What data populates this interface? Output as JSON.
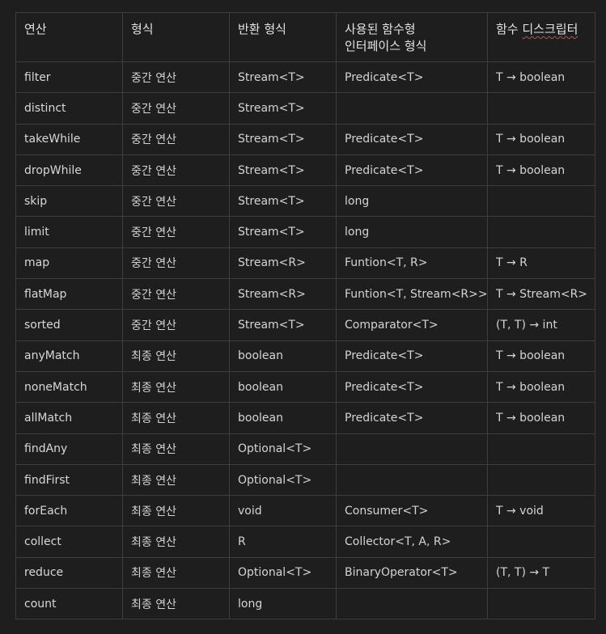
{
  "table": {
    "headers": {
      "op": "연산",
      "kind": "형식",
      "return_type": "반환 형식",
      "fi_type_line1": "사용된 함수형",
      "fi_type_line2": "인터페이스 형식",
      "descriptor_prefix": "함수 ",
      "descriptor_word": "디스크립터"
    },
    "rows": [
      {
        "op": "filter",
        "kind": "중간 연산",
        "ret": "Stream<T>",
        "fi": "Predicate<T>",
        "desc": "T → boolean"
      },
      {
        "op": "distinct",
        "kind": "중간 연산",
        "ret": "Stream<T>",
        "fi": "",
        "desc": ""
      },
      {
        "op": "takeWhile",
        "kind": "중간 연산",
        "ret": "Stream<T>",
        "fi": "Predicate<T>",
        "desc": "T → boolean"
      },
      {
        "op": "dropWhile",
        "kind": "중간 연산",
        "ret": "Stream<T>",
        "fi": "Predicate<T>",
        "desc": "T → boolean"
      },
      {
        "op": "skip",
        "kind": "중간 연산",
        "ret": "Stream<T>",
        "fi": "long",
        "desc": ""
      },
      {
        "op": "limit",
        "kind": "중간 연산",
        "ret": "Stream<T>",
        "fi": "long",
        "desc": ""
      },
      {
        "op": "map",
        "kind": "중간 연산",
        "ret": "Stream<R>",
        "fi": "Funtion<T, R>",
        "desc": "T → R"
      },
      {
        "op": "flatMap",
        "kind": "중간 연산",
        "ret": "Stream<R>",
        "fi": "Funtion<T, Stream<R>>",
        "desc": "T → Stream<R>"
      },
      {
        "op": "sorted",
        "kind": "중간 연산",
        "ret": "Stream<T>",
        "fi": "Comparator<T>",
        "desc": "(T, T) → int"
      },
      {
        "op": "anyMatch",
        "kind": "최종 연산",
        "ret": "boolean",
        "fi": "Predicate<T>",
        "desc": "T → boolean"
      },
      {
        "op": "noneMatch",
        "kind": "최종 연산",
        "ret": "boolean",
        "fi": "Predicate<T>",
        "desc": "T → boolean"
      },
      {
        "op": "allMatch",
        "kind": "최종 연산",
        "ret": "boolean",
        "fi": "Predicate<T>",
        "desc": "T → boolean"
      },
      {
        "op": "findAny",
        "kind": "최종 연산",
        "ret": "Optional<T>",
        "fi": "",
        "desc": ""
      },
      {
        "op": "findFirst",
        "kind": "최종 연산",
        "ret": "Optional<T>",
        "fi": "",
        "desc": ""
      },
      {
        "op": "forEach",
        "kind": "최종 연산",
        "ret": "void",
        "fi": "Consumer<T>",
        "desc": "T → void"
      },
      {
        "op": "collect",
        "kind": "최종 연산",
        "ret": "R",
        "fi": "Collector<T, A, R>",
        "desc": ""
      },
      {
        "op": "reduce",
        "kind": "최종 연산",
        "ret": "Optional<T>",
        "fi": "BinaryOperator<T>",
        "desc": "(T, T) → T"
      },
      {
        "op": "count",
        "kind": "최종 연산",
        "ret": "long",
        "fi": "",
        "desc": ""
      }
    ]
  },
  "colors": {
    "background": "#1e1e1e",
    "border": "#3e3e3e",
    "text": "#d4d4d4",
    "spellcheck_underline": "#c94a4a"
  }
}
